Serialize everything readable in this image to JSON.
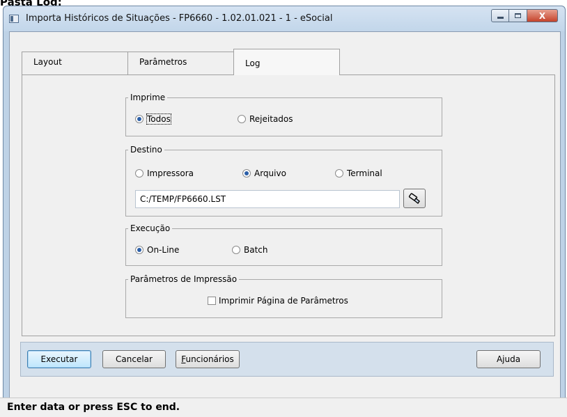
{
  "caption": "Pasta Log:",
  "window": {
    "title": "Importa Históricos de Situações - FP6660 - 1.02.01.021 - 1 - eSocial",
    "close_glyph": "X"
  },
  "tabs": [
    {
      "label": "Layout",
      "active": false
    },
    {
      "label": "Parâmetros",
      "active": false
    },
    {
      "label": "Log",
      "active": true
    }
  ],
  "imprime": {
    "legend": "Imprime",
    "options": [
      {
        "label": "Todos",
        "selected": true
      },
      {
        "label": "Rejeitados",
        "selected": false
      }
    ]
  },
  "destino": {
    "legend": "Destino",
    "options": [
      {
        "label": "Impressora",
        "selected": false
      },
      {
        "label": "Arquivo",
        "selected": true
      },
      {
        "label": "Terminal",
        "selected": false
      }
    ],
    "path_value": "C:/TEMP/FP6660.LST",
    "browse_icon": "flashlight-icon"
  },
  "execucao": {
    "legend": "Execução",
    "options": [
      {
        "label": "On-Line",
        "selected": true
      },
      {
        "label": "Batch",
        "selected": false
      }
    ]
  },
  "parametros_impressao": {
    "legend": "Parâmetros de Impressão",
    "checkbox_label": "Imprimir Página de Parâmetros",
    "checked": false
  },
  "buttons": {
    "executar": "Executar",
    "cancelar": "Cancelar",
    "funcionarios_first": "F",
    "funcionarios_rest": "uncionários",
    "ajuda": "Ajuda"
  },
  "status": "Enter data or press ESC to end.",
  "colors": {
    "window_frame": "#bed2e6",
    "selected_radio": "#2b5fa8",
    "close_button": "#c4432b"
  }
}
